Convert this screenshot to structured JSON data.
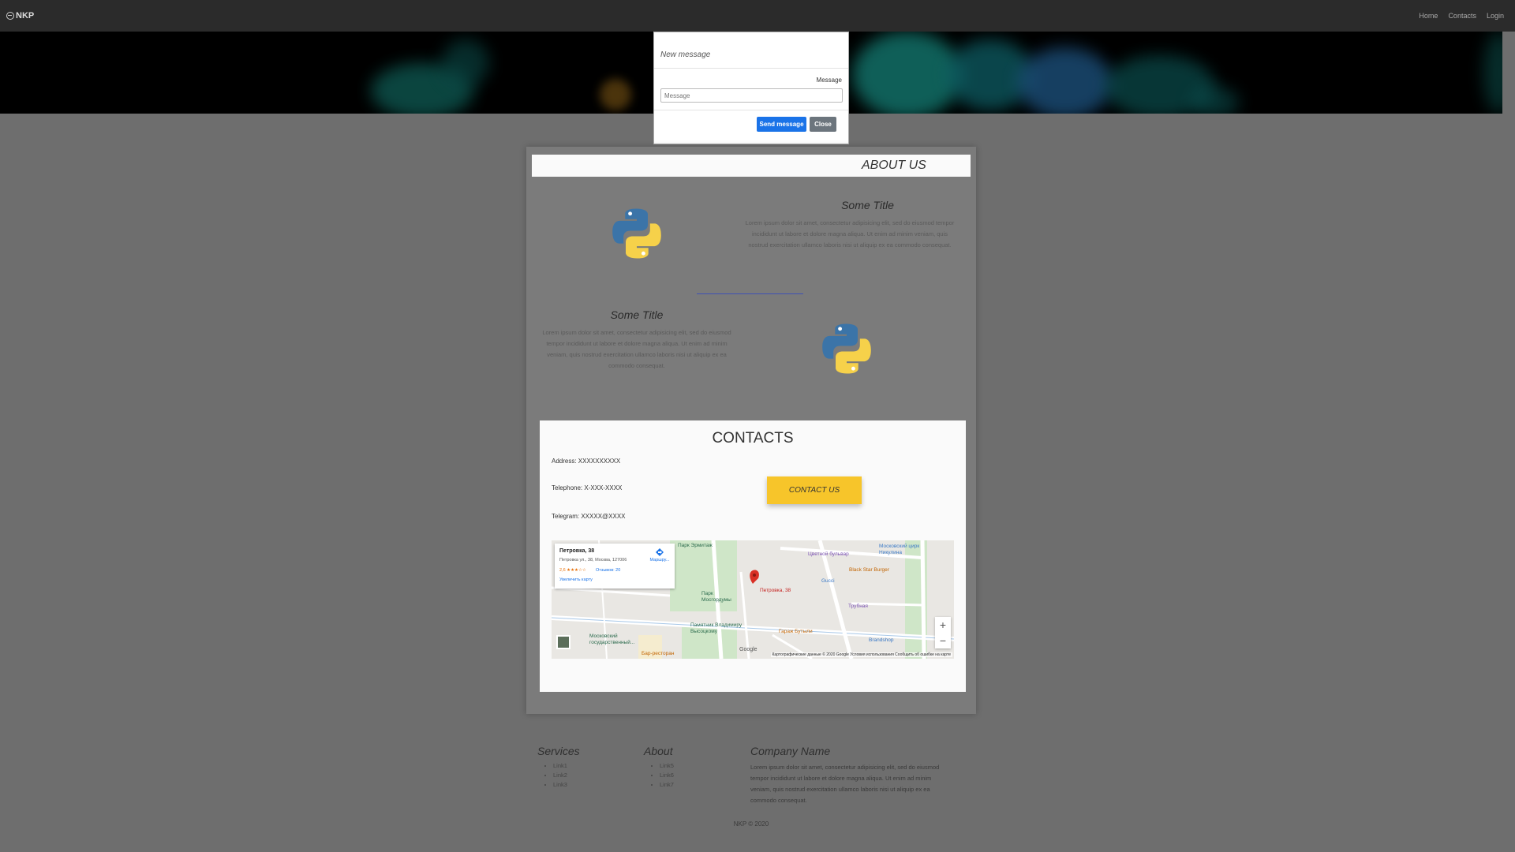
{
  "nav": {
    "brand": "NKP",
    "links": [
      "Home",
      "Contacts",
      "Login"
    ]
  },
  "modal": {
    "title": "New message",
    "label": "Message",
    "placeholder": "Message",
    "send_label": "Send message",
    "close_label": "Close"
  },
  "about": {
    "title": "ABOUT US",
    "items": [
      {
        "title": "Some Title",
        "text": "Lorem ipsum dolor sit amet, consectetur adipisicing elit, sed do eiusmod tempor incididunt ut labore et dolore magna aliqua. Ut enim ad minim veniam, quis nostrud exercitation ullamco laboris nisi ut aliquip ex ea commodo consequat."
      },
      {
        "title": "Some Title",
        "text": "Lorem ipsum dolor sit amet, consectetur adipisicing elit, sed do eiusmod tempor incididunt ut labore et dolore magna aliqua. Ut enim ad minim veniam, quis nostrud exercitation ullamco laboris nisi ut aliquip ex ea commodo consequat."
      }
    ]
  },
  "contacts": {
    "title": "CONTACTS",
    "address": "Address: XXXXXXXXXX",
    "telephone": "Telephone: X-XXX-XXXX",
    "telegram": "Telegram: XXXXX@XXXX",
    "button_label": "CONTACT US"
  },
  "map": {
    "card": {
      "title": "Петровка, 38",
      "address": "Петровка ул., 38, Москва, 127006",
      "rating": "2,6 ★★★☆☆",
      "reviews": "Отзывов: 20",
      "enlarge": "Увеличить карту",
      "route": "Маршру..."
    },
    "labels": [
      "Петровка, 38",
      "Цветной бульвар",
      "Московский цирк Никулина",
      "Black Star Burger",
      "Gucci",
      "Трубная",
      "Памятник Владимиру Высоцкому",
      "Гараж Бутыли",
      "Brandshop",
      "Московский государственный...",
      "Бар-ресторан",
      "Парк Эрмитаж",
      "Парк Мосгордумы"
    ],
    "zoom_in": "+",
    "zoom_out": "−",
    "google": "Google",
    "credits": "Картографические данные © 2020 Google   Условия использования   Сообщить об ошибке на карте"
  },
  "footer": {
    "services": {
      "title": "Services",
      "links": [
        "Link1",
        "Link2",
        "Link3"
      ]
    },
    "about": {
      "title": "About",
      "links": [
        "Link5",
        "Link6",
        "Link7"
      ]
    },
    "company": {
      "title": "Company Name",
      "text": "Lorem ipsum dolor sit amet, consectetur adipisicing elit, sed do eiusmod tempor incididunt ut labore et dolore magna aliqua. Ut enim ad minim veniam, quis nostrud exercitation ullamco laboris nisi ut aliquip ex ea commodo consequat."
    },
    "copyright": "NKP © 2020"
  },
  "colors": {
    "navbar": "#2b2b2b",
    "overlay_bg": "#6e6e6e",
    "primary_button": "#1a73e8",
    "secondary_button": "#6c757d",
    "accent_yellow": "#f7c52a"
  },
  "icons": [
    "globe-icon",
    "python-logo-icon",
    "map-pin-icon",
    "directions-icon"
  ]
}
